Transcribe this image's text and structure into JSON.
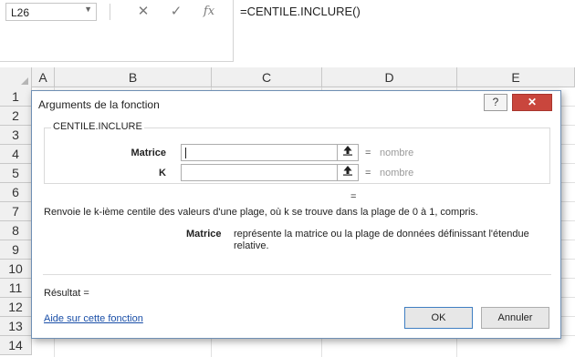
{
  "formula_bar": {
    "name_box": "L26",
    "cancel_icon": "✕",
    "enter_icon": "✓",
    "function_icon": "fx",
    "formula": "=CENTILE.INCLURE()"
  },
  "grid": {
    "columns": [
      "A",
      "B",
      "C",
      "D",
      "E"
    ],
    "rows": [
      "1",
      "2",
      "3",
      "4",
      "5",
      "6",
      "7",
      "8",
      "9",
      "10",
      "11",
      "12",
      "13",
      "14"
    ]
  },
  "dialog": {
    "title": "Arguments de la fonction",
    "help_label": "?",
    "close_label": "✕",
    "function_name": "CENTILE.INCLURE",
    "args": [
      {
        "label": "Matrice",
        "value": "",
        "hint": "nombre",
        "equals": "="
      },
      {
        "label": "K",
        "value": "",
        "hint": "nombre",
        "equals": "="
      }
    ],
    "result_equals": "=",
    "description": "Renvoie le k-ième centile des valeurs d'une plage, où k se trouve dans la plage de 0 à 1, compris.",
    "arg_desc_name": "Matrice",
    "arg_desc_text": "représente la matrice ou la plage de données définissant l'étendue relative.",
    "result_label": "Résultat =",
    "help_link": "Aide sur cette fonction",
    "ok_label": "OK",
    "cancel_label": "Annuler"
  }
}
